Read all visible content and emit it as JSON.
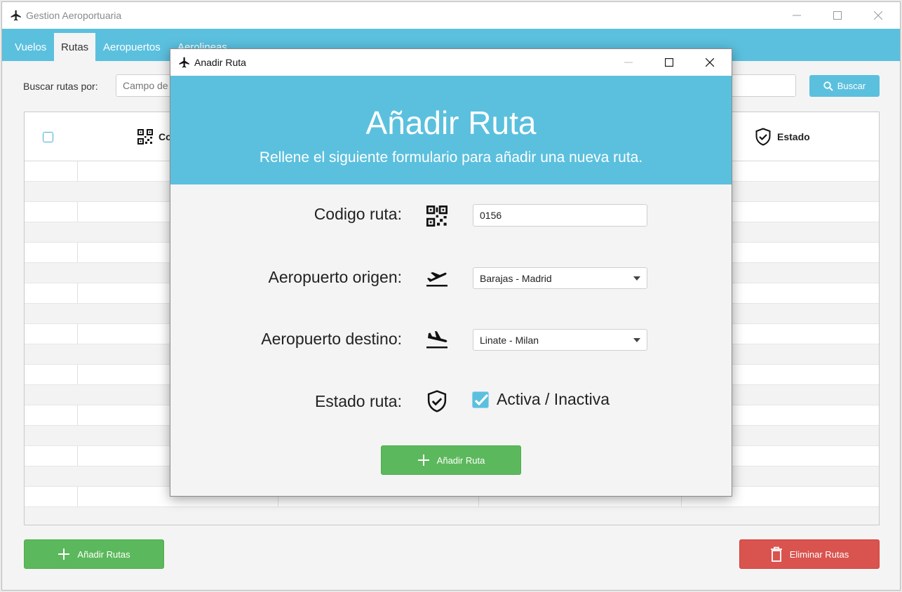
{
  "main_window": {
    "title": "Gestion Aeroportuaria",
    "tabs": [
      {
        "label": "Vuelos"
      },
      {
        "label": "Rutas"
      },
      {
        "label": "Aeropuertos"
      },
      {
        "label": "Aerolineas"
      }
    ],
    "active_tab": "Rutas",
    "search": {
      "label": "Buscar rutas por:",
      "placeholder": "Campo de",
      "button_label": "Buscar"
    },
    "table": {
      "columns": [
        {
          "label": "",
          "icon": "checkbox"
        },
        {
          "label": "Co",
          "icon": "qr-code-icon"
        },
        {
          "label": "",
          "icon": ""
        },
        {
          "label": "",
          "icon": ""
        },
        {
          "label": "Estado",
          "icon": "shield-check-icon"
        }
      ]
    },
    "add_button_label": "Añadir Rutas",
    "delete_button_label": "Eliminar Rutas"
  },
  "dialog": {
    "title": "Anadir Ruta",
    "heading": "Añadir Ruta",
    "subheading": "Rellene el siguiente formulario para añadir una nueva ruta.",
    "fields": {
      "codigo": {
        "label": "Codigo ruta:",
        "value": "0156",
        "icon": "qr-code-icon"
      },
      "origen": {
        "label": "Aeropuerto origen:",
        "value": "Barajas - Madrid",
        "icon": "plane-takeoff-icon"
      },
      "destino": {
        "label": "Aeropuerto destino:",
        "value": "Linate - Milan",
        "icon": "plane-landing-icon"
      },
      "estado": {
        "label": "Estado ruta:",
        "checkbox_label": "Activa / Inactiva",
        "checked": true,
        "icon": "shield-check-icon"
      }
    },
    "submit_label": "Añadir Ruta"
  },
  "colors": {
    "accent": "#5bc0de",
    "success": "#5cb85c",
    "danger": "#d9534f"
  }
}
